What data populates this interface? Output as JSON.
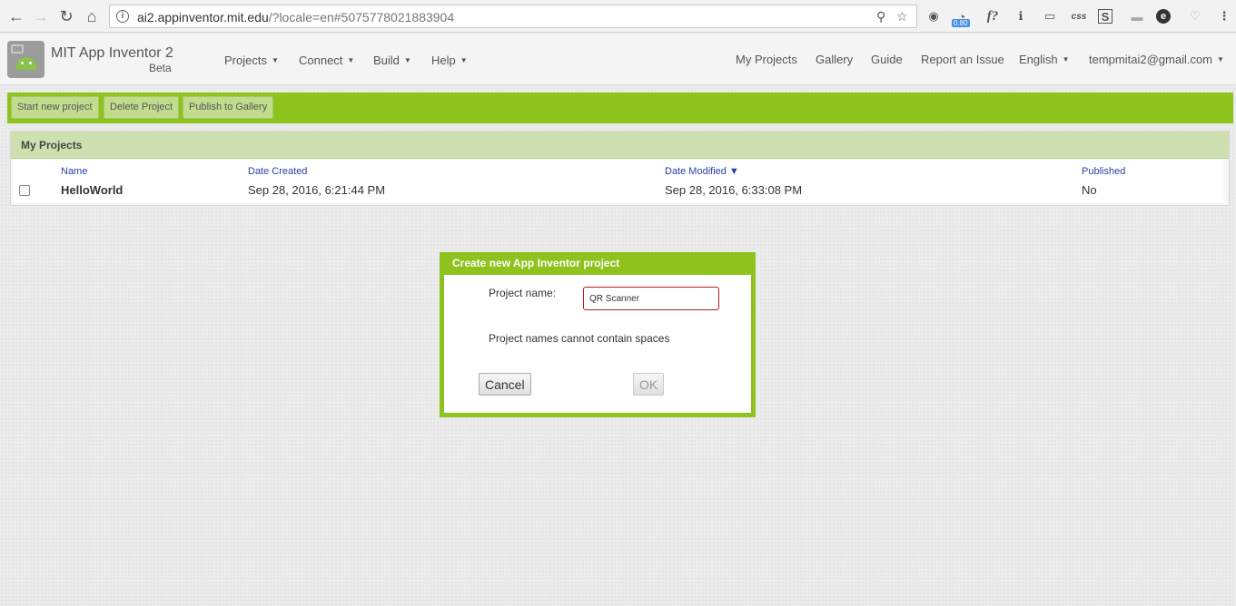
{
  "browser": {
    "url_host": "ai2.appinventor.mit.edu",
    "url_rest": "/?locale=en#5075778021883904",
    "extension_badge": "0.80",
    "ext_labels": {
      "formula": "f?",
      "css": "css",
      "s_box": "S",
      "e_circle": "e"
    }
  },
  "header": {
    "brand_title": "MIT App Inventor 2",
    "brand_subtitle": "Beta",
    "menus": [
      "Projects",
      "Connect",
      "Build",
      "Help"
    ],
    "links": [
      "My Projects",
      "Gallery",
      "Guide",
      "Report an Issue"
    ],
    "language": "English",
    "account": "tempmitai2@gmail.com"
  },
  "toolbar": {
    "start_new": "Start new project",
    "delete": "Delete Project",
    "publish": "Publish to Gallery"
  },
  "projects": {
    "title": "My Projects",
    "columns": {
      "name": "Name",
      "created": "Date Created",
      "modified": "Date Modified ▼",
      "published": "Published"
    },
    "rows": [
      {
        "name": "HelloWorld",
        "created": "Sep 28, 2016, 6:21:44 PM",
        "modified": "Sep 28, 2016, 6:33:08 PM",
        "published": "No"
      }
    ]
  },
  "dialog": {
    "title": "Create new App Inventor project",
    "name_label": "Project name:",
    "name_value": "QR Scanner",
    "error_message": "Project names cannot contain spaces",
    "cancel": "Cancel",
    "ok": "OK"
  },
  "colors": {
    "toolbar_green": "#8ec31e",
    "panel_header": "#cfe0b0",
    "link_blue": "#2b3ea7",
    "error_red": "#c0171b"
  }
}
